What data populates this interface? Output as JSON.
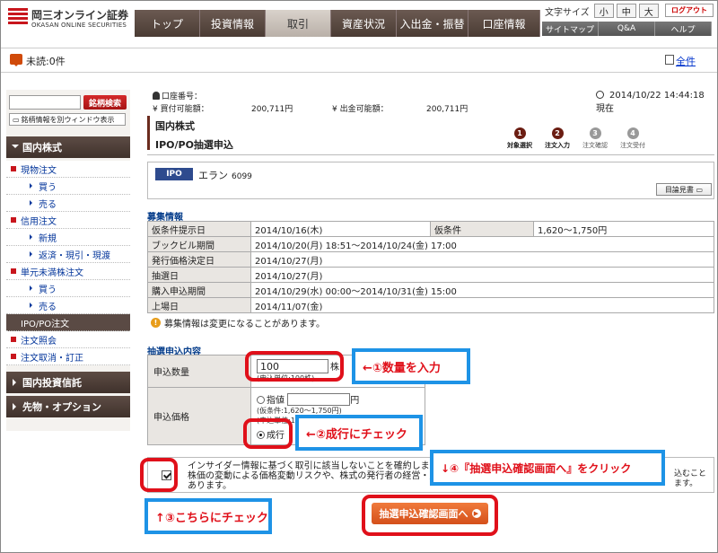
{
  "header": {
    "logo_jp": "岡三オンライン証券",
    "logo_en": "OKASAN ONLINE SECURITIES",
    "nav": [
      "トップ",
      "投資情報",
      "取引",
      "資産状況",
      "入出金・振替",
      "口座情報"
    ],
    "text_size_label": "文字サイズ",
    "text_sizes": [
      "小",
      "中",
      "大"
    ],
    "logout": "ログアウト",
    "subnav": [
      "サイトマップ",
      "Q&A",
      "ヘルプ"
    ]
  },
  "notice": {
    "unread": "未読:0件",
    "all": "全件"
  },
  "sidebar": {
    "search_button": "銘柄検索",
    "search_window": "銘柄情報を別ウィンドウ表示",
    "section_domestic": "国内株式",
    "items": {
      "genbutsu": "現物注文",
      "buy1": "買う",
      "sell1": "売る",
      "shinyo": "信用注文",
      "shinki": "新規",
      "hensai": "返済・現引・現渡",
      "tangen": "単元未満株注文",
      "buy2": "買う",
      "sell2": "売る",
      "ipo": "IPO/PO注文",
      "shokai": "注文照会",
      "torikeshi": "注文取消・訂正"
    },
    "section_trust": "国内投資信託",
    "section_futures": "先物・オプション"
  },
  "account": {
    "number_label": "口座番号：",
    "buying_power_label": "¥ 買付可能額：",
    "buying_power": "200,711円",
    "withdraw_label": "¥ 出金可能額：",
    "withdraw": "200,711円",
    "datetime": "2014/10/22 14:44:18 現在"
  },
  "page": {
    "title1": "国内株式",
    "title2": "IPO/PO抽選申込",
    "steps": [
      {
        "num": "1",
        "label": "対象選択"
      },
      {
        "num": "2",
        "label": "注文入力"
      },
      {
        "num": "3",
        "label": "注文確認"
      },
      {
        "num": "4",
        "label": "注文受付"
      }
    ]
  },
  "ipo": {
    "badge": "IPO",
    "name": "エラン",
    "code": "6099",
    "mokuromi": "目論見書"
  },
  "offering": {
    "title": "募集情報",
    "rows": {
      "kari_label": "仮条件提示日",
      "kari_value": "2014/10/16(木)",
      "kari_cond_label": "仮条件",
      "kari_cond_value": "1,620～1,750円",
      "bb_label": "ブックビル期間",
      "bb_value": "2014/10/20(月) 18:51～2014/10/24(金) 17:00",
      "price_label": "発行価格決定日",
      "price_value": "2014/10/27(月)",
      "lottery_label": "抽選日",
      "lottery_value": "2014/10/27(月)",
      "purchase_label": "購入申込期間",
      "purchase_value": "2014/10/29(水) 00:00～2014/10/31(金) 15:00",
      "listing_label": "上場日",
      "listing_value": "2014/11/07(金)"
    },
    "note": "募集情報は変更になることがあります。"
  },
  "form": {
    "title": "抽選申込内容",
    "qty_label": "申込数量",
    "qty_value": "100",
    "qty_unit": "株",
    "qty_note": "(申込単位:100株)",
    "price_label": "申込価格",
    "limit_label": "指値",
    "limit_unit": "円",
    "limit_note1": "(仮条件:1,620～1,750円)",
    "limit_note2": "(申込単位:10円)",
    "market_label": "成行"
  },
  "agree": {
    "line1": "インサイダー情報に基づく取引に該当しないことを確約します。",
    "line2": "株価の変動による価格変動リスクや、株式の発行者の経営・財",
    "line3": "あります。",
    "tail1": "込むこと",
    "tail2": "ます。"
  },
  "submit": "抽選申込確認画面へ",
  "annotations": {
    "a1": "←①数量を入力",
    "a2": "←②成行にチェック",
    "a3": "↑③こちらにチェック",
    "a4": "↓④『抽選申込確認画面へ』をクリック"
  }
}
